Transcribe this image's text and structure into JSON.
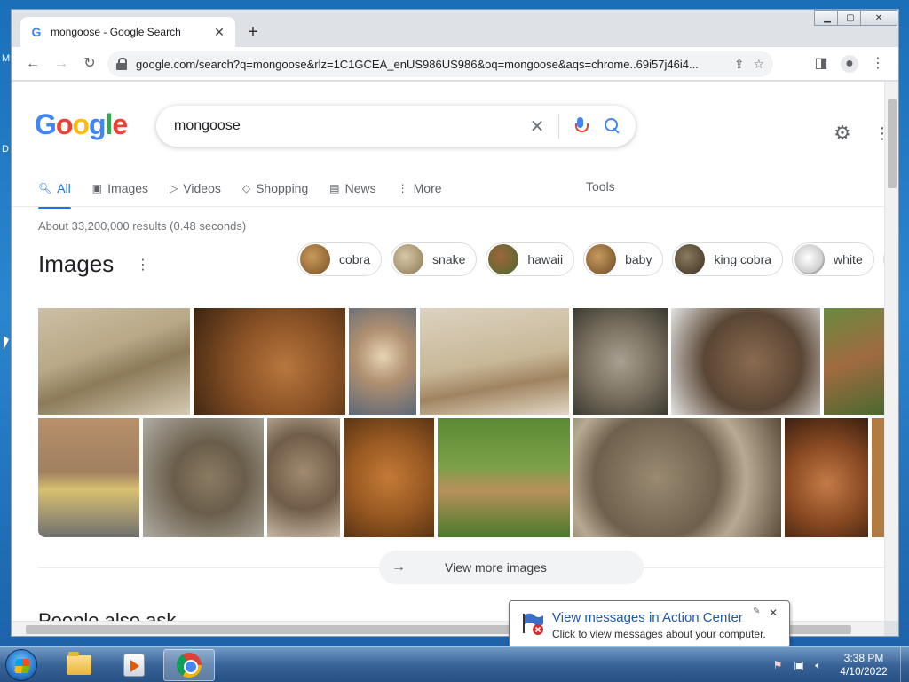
{
  "browser": {
    "tab_title": "mongoose - Google Search",
    "tab_favicon": "G",
    "tab_close": "✕",
    "new_tab": "+",
    "url": "google.com/search?q=mongoose&rlz=1C1GCEA_enUS986US986&oq=mongoose&aqs=chrome..69i57j46i4..."
  },
  "search": {
    "query": "mongoose",
    "stats": "About 33,200,000 results (0.48 seconds)"
  },
  "nav": {
    "tabs": [
      {
        "label": "All",
        "icon": "search-icon"
      },
      {
        "label": "Images",
        "icon": "image-icon"
      },
      {
        "label": "Videos",
        "icon": "play-icon"
      },
      {
        "label": "Shopping",
        "icon": "tag-icon"
      },
      {
        "label": "News",
        "icon": "news-icon"
      },
      {
        "label": "More",
        "icon": "more-vert-icon"
      }
    ],
    "tools": "Tools"
  },
  "images_section": {
    "heading": "Images",
    "chips": [
      "cobra",
      "snake",
      "hawaii",
      "baby",
      "king cobra",
      "white"
    ],
    "view_more": "View more images"
  },
  "people_also_ask": "People also ask",
  "balloon": {
    "title": "View messages in Action Center",
    "text": "Click to view messages about your computer."
  },
  "taskbar": {
    "time": "3:38 PM",
    "date": "4/10/2022"
  },
  "colors": {
    "accent": "#1a73e8",
    "google_blue": "#4285f4",
    "google_red": "#ea4335",
    "google_yellow": "#fbbc05",
    "google_green": "#34a853"
  }
}
